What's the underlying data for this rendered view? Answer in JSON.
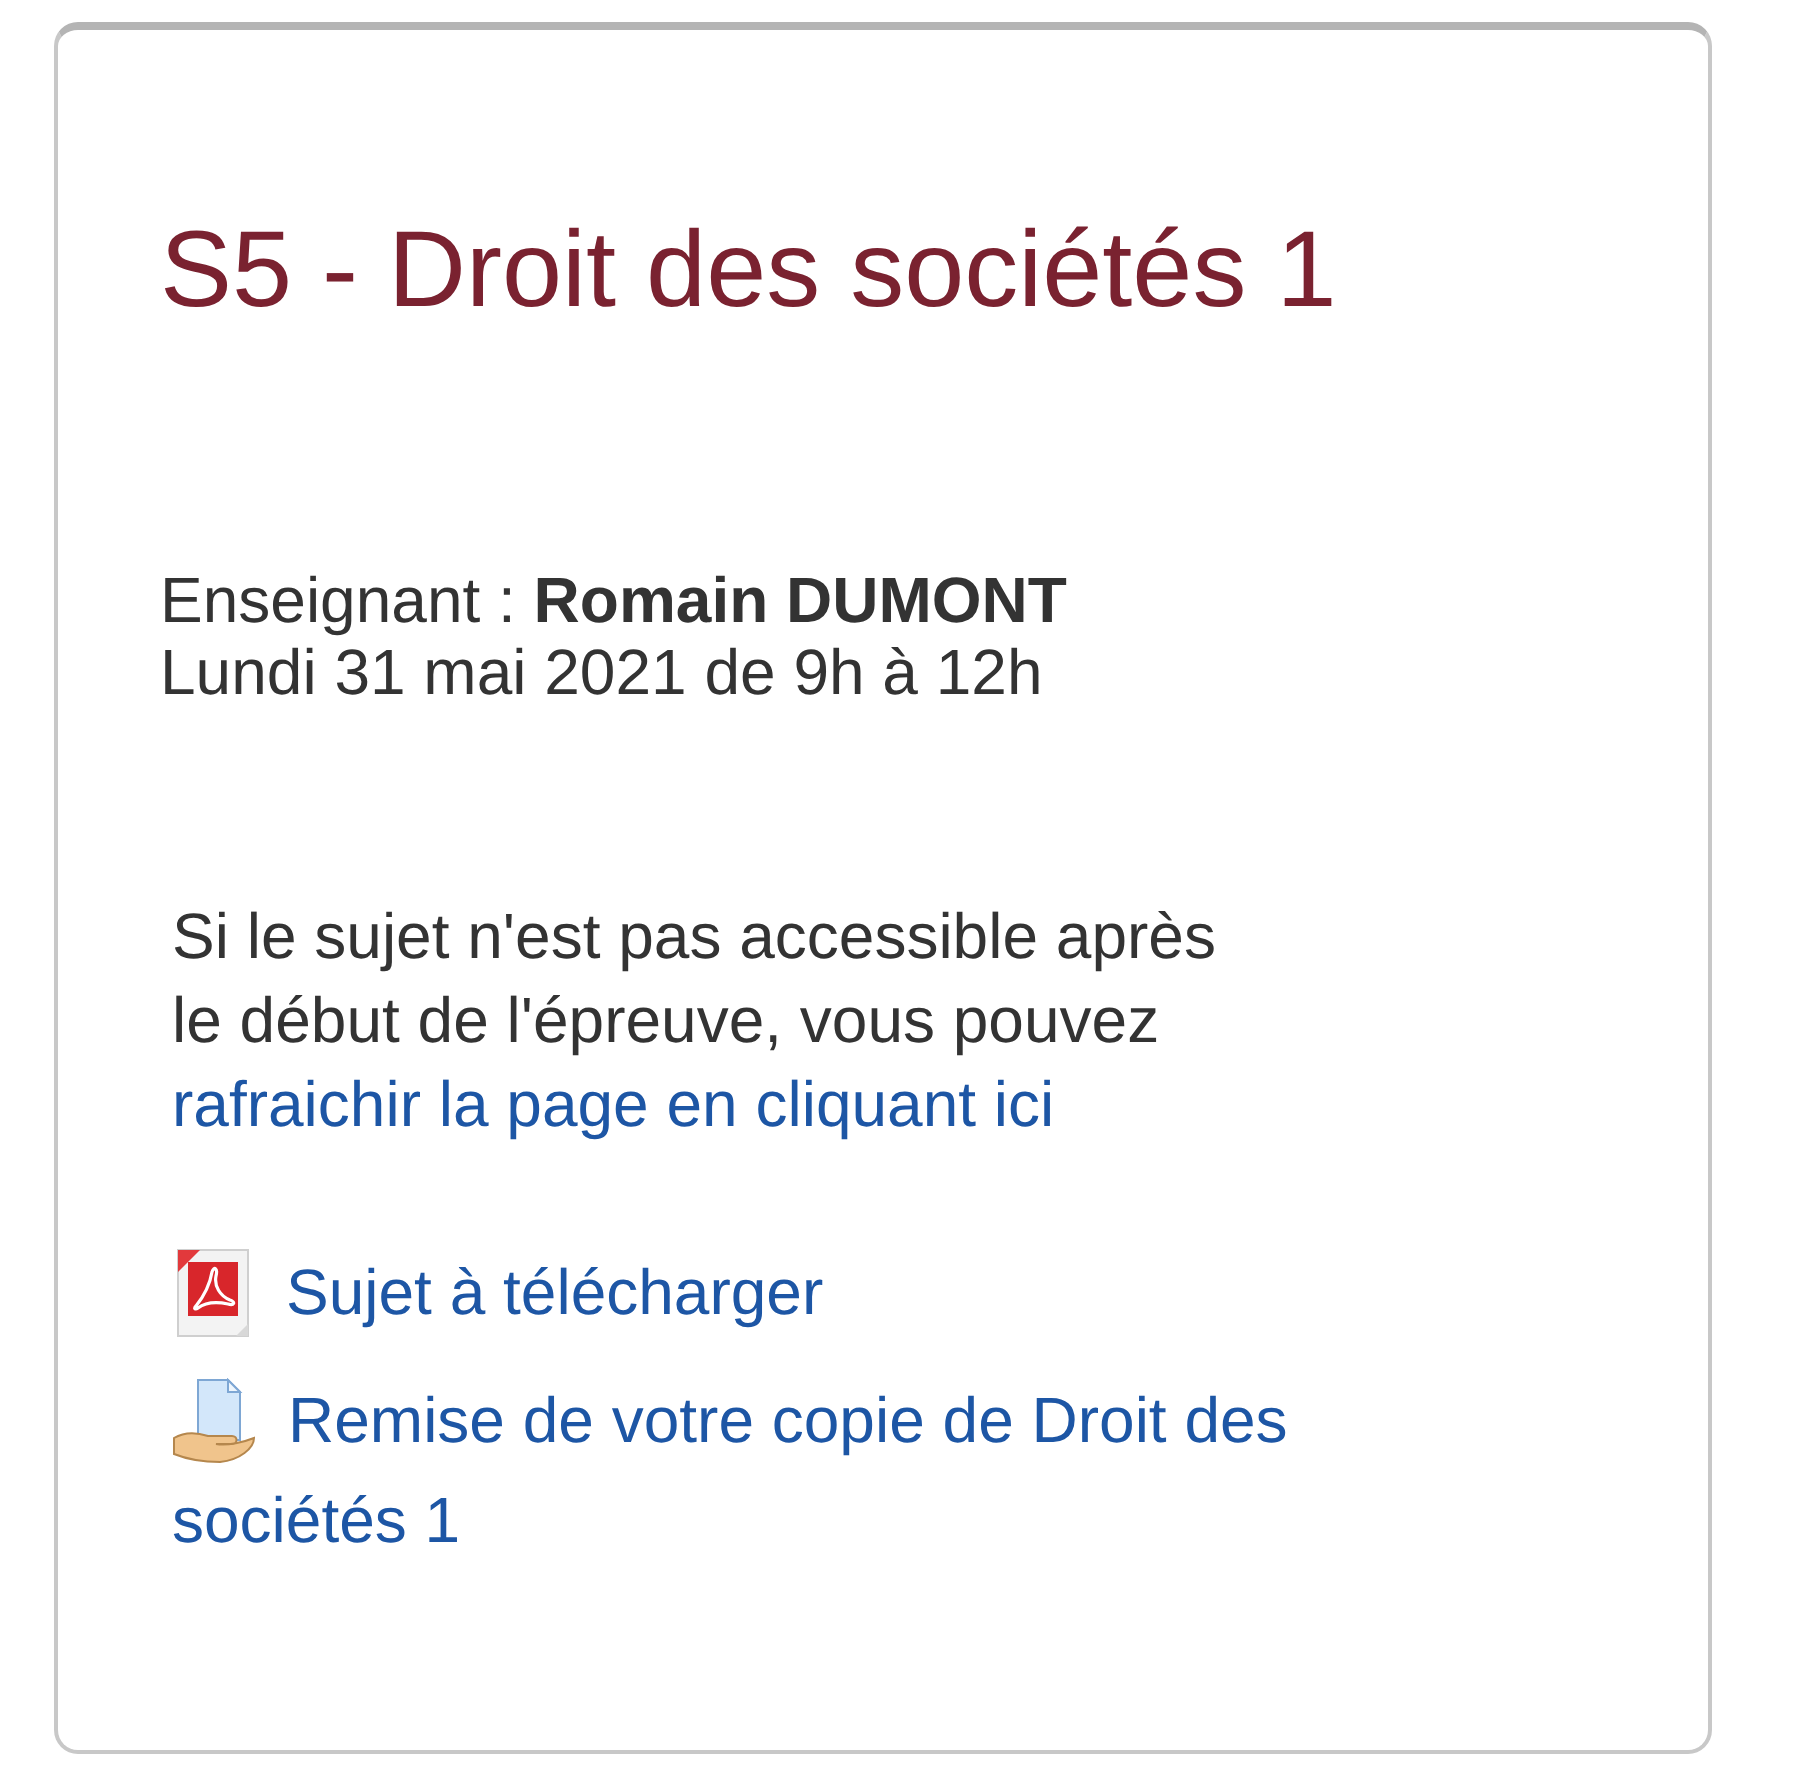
{
  "card": {
    "title": "S5 - Droit des sociétés 1",
    "teacher": "Enseignant : **Romain DUMONT**",
    "schedule": "Lundi 31 mai 2021 de 9h à 12h",
    "notice": {
      "text": "Si le sujet n'est pas accessible après le début de l'épreuve, vous pouvez",
      "link": "rafraichir la page en cliquant ici"
    },
    "resources": [
      {
        "kind": "pdf",
        "label": "Sujet à télécharger"
      },
      {
        "kind": "assignment",
        "label": "Remise de votre copie de Droit des sociétés 1"
      }
    ]
  }
}
